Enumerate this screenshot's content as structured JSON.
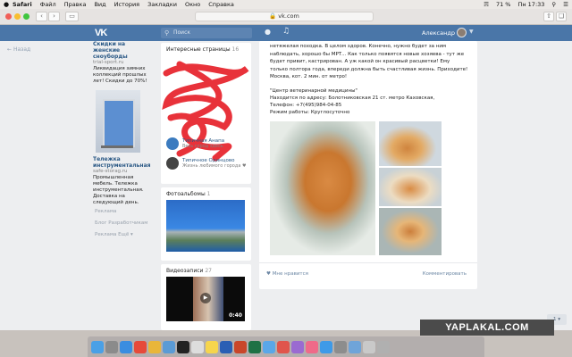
{
  "menubar": {
    "apple": "",
    "items": [
      "Safari",
      "Файл",
      "Правка",
      "Вид",
      "История",
      "Закладки",
      "Окно",
      "Справка"
    ],
    "battery": "71 %",
    "time": "Пн 17:33"
  },
  "toolbar": {
    "url": "vk.com"
  },
  "header": {
    "logo": "VK",
    "search_placeholder": "Поиск",
    "username": "Александр"
  },
  "sidebar": {
    "back": "Назад"
  },
  "ad1": {
    "title": "Скидки на женские сноуборды",
    "site": "trial-sport.ru",
    "desc": "Ликвидация зимних коллекций прошлых лет! Скидки до 70%!"
  },
  "ad2": {
    "title": "Тележка инструментальная",
    "site": "safe-storag.ru",
    "desc": "Промышленная мебель. Тележка инструментальная. Доставка на следующий день."
  },
  "footer": {
    "line1": "Реклама",
    "line2": "Блог   Разработчикам",
    "line3": "Реклама   Ещё ▾"
  },
  "pages": {
    "title": "Интересные страницы",
    "count": "16",
    "items": [
      {
        "name": "Типичная Анапа",
        "status": "Весь город здесь"
      },
      {
        "name": "Типичное Одинцово",
        "status": "Жизнь любимого города ♥"
      }
    ]
  },
  "albums": {
    "title": "Фотоальбомы",
    "count": "1"
  },
  "videos": {
    "title": "Видеозаписи",
    "count": "27",
    "duration": "0:40"
  },
  "post": {
    "text": "нетяжелая походка. В целом здоров. Конечно, нужно будет за ним наблюдать, хорошо бы МРТ... Как только появятся новые хозяева - тут же будет привит, кастрирован. А уж какой он красивый расцветки! Ему только полтора года, впереди должна быть счастливая жизнь. Приходите! Москва, кот. 2 мин. от метро!",
    "clinic": "\"Центр ветеринарной медицины\"",
    "address": "Находится по адресу: Болотниковская 21 ст. метро Каховская,",
    "phone": "Телефон: +7(495)984-04-85",
    "hours": "Режим работы: Круглосуточно",
    "like": "Мне нравится",
    "comment": "Комментировать"
  },
  "pager": {
    "label": "1 ▾"
  },
  "watermark": "YAPLAKAL.COM"
}
